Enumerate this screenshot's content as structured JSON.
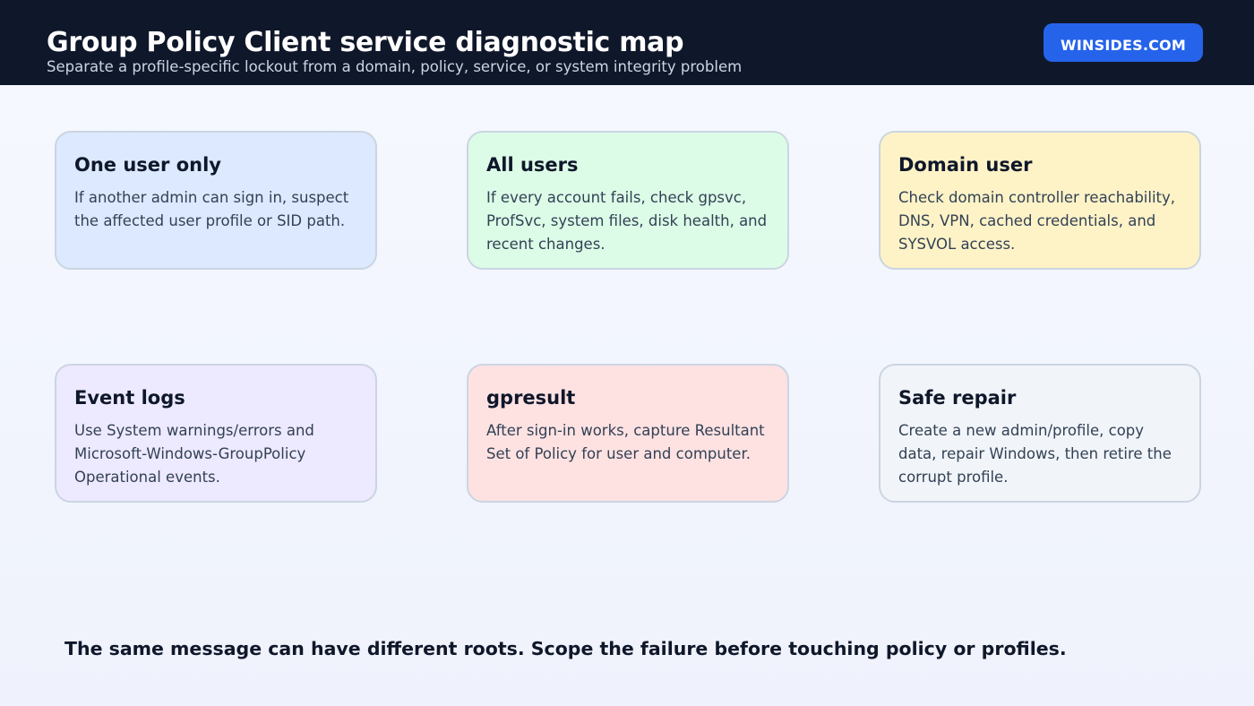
{
  "header": {
    "title": "Group Policy Client service diagnostic map",
    "subtitle": "Separate a profile-specific lockout from a domain, policy, service, or system integrity problem",
    "brand": "WINSIDES.COM"
  },
  "cards": [
    {
      "title": "One user only",
      "body": "If another admin can sign in, suspect the affected user profile or SID path.",
      "color": "#dce9ff"
    },
    {
      "title": "All users",
      "body": "If every account fails, check gpsvc, ProfSvc, system files, disk health, and recent changes.",
      "color": "#dcfce7"
    },
    {
      "title": "Domain user",
      "body": "Check domain controller reachability, DNS, VPN, cached credentials, and SYSVOL access.",
      "color": "#fef3c7"
    },
    {
      "title": "Event logs",
      "body": "Use System warnings/errors and Microsoft-Windows-GroupPolicy Operational events.",
      "color": "#ede9fe"
    },
    {
      "title": "gpresult",
      "body": "After sign-in works, capture Resultant Set of Policy for user and computer.",
      "color": "#fee2e2"
    },
    {
      "title": "Safe repair",
      "body": "Create a new admin/profile, copy data, repair Windows, then retire the corrupt profile.",
      "color": "#f1f5f9"
    }
  ],
  "footnote": "The same message can have different roots. Scope the failure before touching policy or profiles.",
  "colors": {
    "header_bg": "#0f172a",
    "brand_bg": "#2563eb",
    "card_border": "#cbd5e1"
  }
}
